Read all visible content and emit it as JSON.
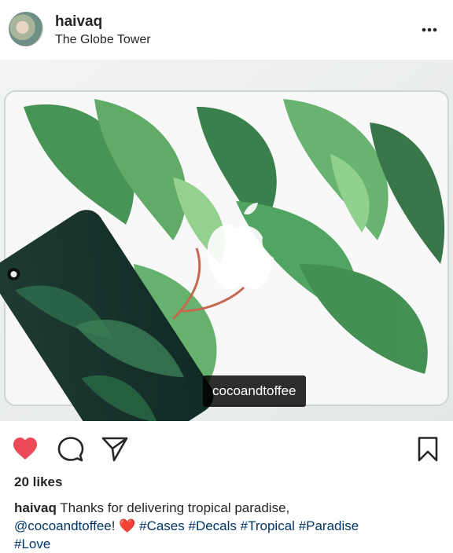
{
  "post": {
    "username": "haivaq",
    "location": "The Globe Tower",
    "photo_tag": "cocoandtoffee",
    "likes": "20 likes",
    "caption": {
      "username": "haivaq",
      "text_1": " Thanks for delivering tropical paradise,",
      "mention": "@cocoandtoffee",
      "text_2": "! ",
      "emoji": "❤️",
      "hashtags": [
        "#Cases",
        "#Decals",
        "#Tropical",
        "#Paradise",
        "#Love"
      ]
    }
  },
  "colors": {
    "like_red": "#ed4956",
    "link_blue": "#003569",
    "text": "#262626"
  },
  "icons": {
    "more": "more-options-icon",
    "like": "heart-icon",
    "comment": "comment-icon",
    "share": "send-icon",
    "save": "bookmark-icon",
    "tagged": "user-tag-icon"
  }
}
